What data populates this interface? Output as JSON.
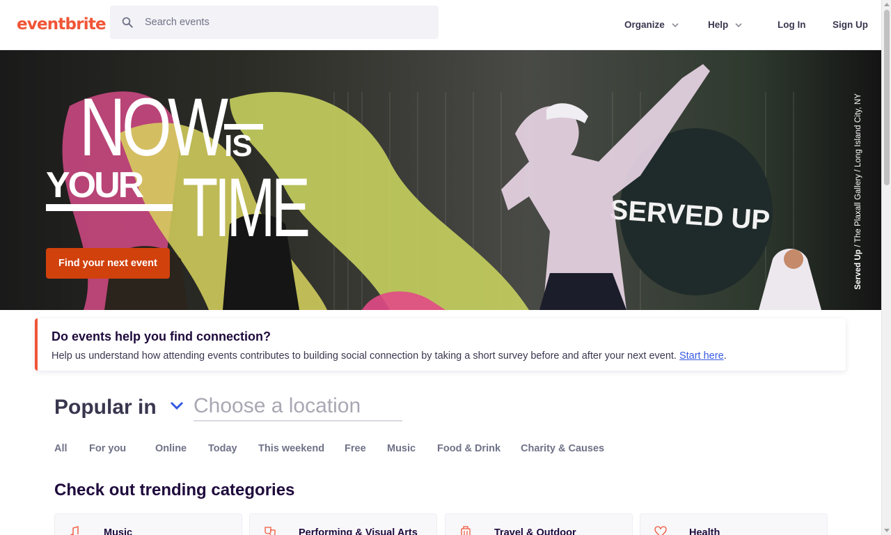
{
  "header": {
    "logo": "eventbrite",
    "search_placeholder": "Search events",
    "nav": {
      "organize": "Organize",
      "help": "Help",
      "login": "Log In",
      "signup": "Sign Up"
    }
  },
  "hero": {
    "headline": {
      "now": "NOW",
      "is": "IS",
      "your": "YOUR",
      "time": "TIME"
    },
    "cta": "Find your next event",
    "stage_sign": "SERVED UP",
    "credit_bold": "Served Up",
    "credit_rest": " / The Plaxall Gallery / Long Island City, NY"
  },
  "survey": {
    "title": "Do events help you find connection?",
    "text": "Help us understand how attending events contributes to building social connection by taking a short survey before and after your next event. ",
    "link": "Start here",
    "suffix": "."
  },
  "popular": {
    "label": "Popular in",
    "location_placeholder": "Choose a location",
    "tabs": [
      "All",
      "For you",
      "Online",
      "Today",
      "This weekend",
      "Free",
      "Music",
      "Food & Drink",
      "Charity & Causes"
    ]
  },
  "trending": {
    "title": "Check out trending categories",
    "categories": [
      {
        "label": "Music",
        "icon": "music-icon"
      },
      {
        "label": "Performing & Visual Arts",
        "icon": "theater-masks-icon"
      },
      {
        "label": "Travel & Outdoor",
        "icon": "luggage-icon"
      },
      {
        "label": "Health",
        "icon": "heart-icon"
      }
    ]
  },
  "colors": {
    "brand": "#f05537",
    "cta": "#d1410c",
    "link": "#3659e3",
    "text_dark": "#1e0a3c",
    "text_muted": "#6f7287"
  }
}
